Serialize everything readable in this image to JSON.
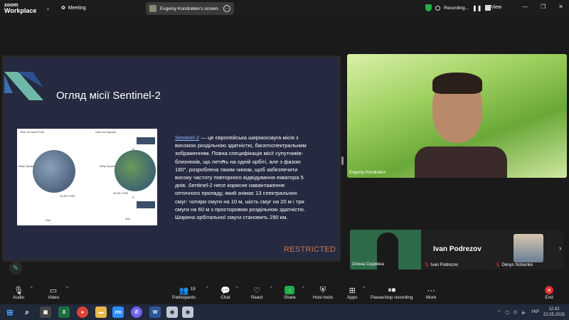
{
  "app": {
    "logo_line1": "zoom",
    "logo_line2": "Workplace"
  },
  "topbar": {
    "meeting_label": "Meeting",
    "share_label": "Evgeniy Kondratiev's screen",
    "recording_label": "Recording...",
    "view_label": "View"
  },
  "slide": {
    "title": "Огляд місії Sentinel-2",
    "image_captions": {
      "north_pole": "View on North Pole",
      "equator": "View on Equator",
      "deep_space_1": "Deep Space",
      "deep_space_2": "Deep Space",
      "ltdn_1": "10:30 LTDN",
      "ltdn_2": "10:30 LTDN",
      "sun_1": "Sun",
      "sun_2": "Sun",
      "n_label": "N",
      "s_label": "S"
    },
    "link_text": "Sentinel-2",
    "body_text": " — це європейська широкосмуга місія з високою роздільною здатністю, багатоспектральним зображенням. Повна специфікація місії супутників-близнюків, що летять на одній орбіті, але з фазою 180°, розроблена таким чином, щоб забезпечити високу частоту повторного відвідування екватора 5 днів. Sentinel-2 несе корисне навантаження оптичного приладу, який знімає 13 спектральних смуг: чотири смуги на 10 м, шість смуг на 20 м і три смуги на 60 м з просторовою роздільною здатністю. Ширина орбітальної смуги становить 290 км.",
    "restricted": "RESTRICTED"
  },
  "video": {
    "main_name": "Evgeniy Kondratiev",
    "tile1_name": "Олена Сидякіна",
    "tile2_big_name": "Ivan Podrezov",
    "tile2_name": "Ivan Podrezov",
    "tile3_name": "Denys Sotsenko"
  },
  "toolbar": {
    "audio": "Audio",
    "video": "Video",
    "participants": "Participants",
    "participants_count": "15",
    "chat": "Chat",
    "react": "React",
    "share": "Share",
    "host_tools": "Host tools",
    "apps": "Apps",
    "pause_stop": "Pause/stop recording",
    "more": "More",
    "end": "End"
  },
  "taskbar": {
    "lang": "УКР",
    "time": "12:42",
    "date": "22.05.2025",
    "zoom_icon_text": "zm"
  },
  "colors": {
    "accent_green": "#1fae4a",
    "end_red": "#e02b2b",
    "slide_bg": "#262a40",
    "restricted": "#c87850"
  }
}
